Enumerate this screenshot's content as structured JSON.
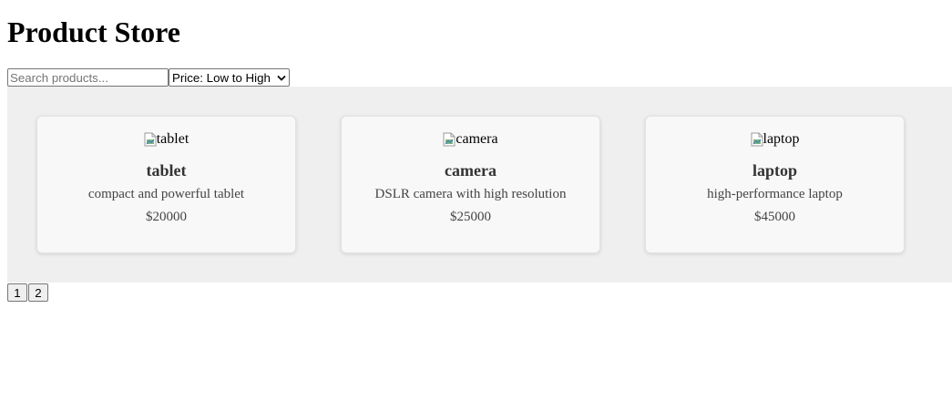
{
  "header": {
    "title": "Product Store"
  },
  "controls": {
    "search_placeholder": "Search products...",
    "search_value": "",
    "sort_selected": "Price: Low to High"
  },
  "products": [
    {
      "image_alt": "tablet",
      "name": "tablet",
      "description": "compact and powerful tablet",
      "price": "$20000"
    },
    {
      "image_alt": "camera",
      "name": "camera",
      "description": "DSLR camera with high resolution",
      "price": "$25000"
    },
    {
      "image_alt": "laptop",
      "name": "laptop",
      "description": "high-performance laptop",
      "price": "$45000"
    }
  ],
  "pagination": {
    "pages": [
      "1",
      "2"
    ]
  },
  "icons": {
    "broken_image": "broken-image-icon",
    "dropdown": "chevron-down-icon"
  }
}
